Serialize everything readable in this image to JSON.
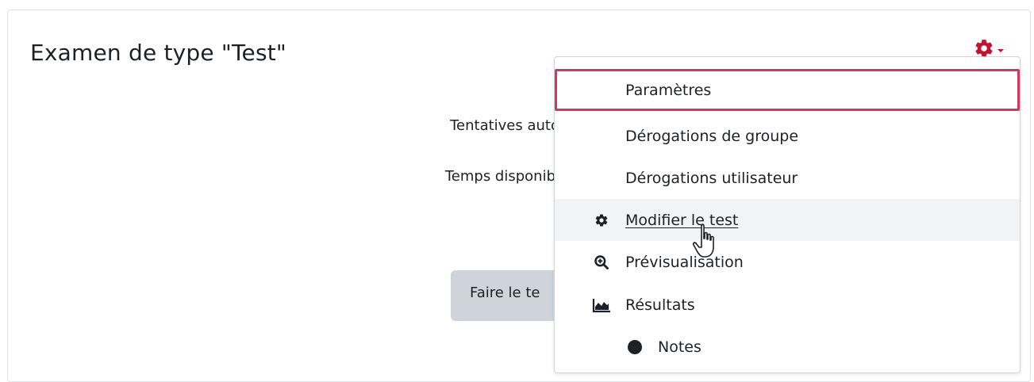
{
  "page": {
    "title": "Examen de type \"Test\"",
    "attempts_label": "Tentatives auto",
    "time_label": "Temps disponibl",
    "start_button": "Faire le te"
  },
  "settings_menu": {
    "toggle_icon": "gear-icon",
    "accent_color": "#c4122f",
    "items": [
      {
        "label": "Paramètres",
        "icon": "",
        "state": "highlighted"
      },
      {
        "label": "Dérogations de groupe",
        "icon": ""
      },
      {
        "label": "Dérogations utilisateur",
        "icon": ""
      },
      {
        "label": "Modifier le test",
        "icon": "gear-icon",
        "state": "hover"
      },
      {
        "label": "Prévisualisation",
        "icon": "zoom-in-icon"
      },
      {
        "label": "Résultats",
        "icon": "area-chart-icon"
      },
      {
        "label": "Notes",
        "icon": "bullet-icon"
      }
    ]
  },
  "colors": {
    "highlight_border": "#d4365c",
    "hover_background": "#f1f3f5",
    "button_background": "#ced4da"
  }
}
